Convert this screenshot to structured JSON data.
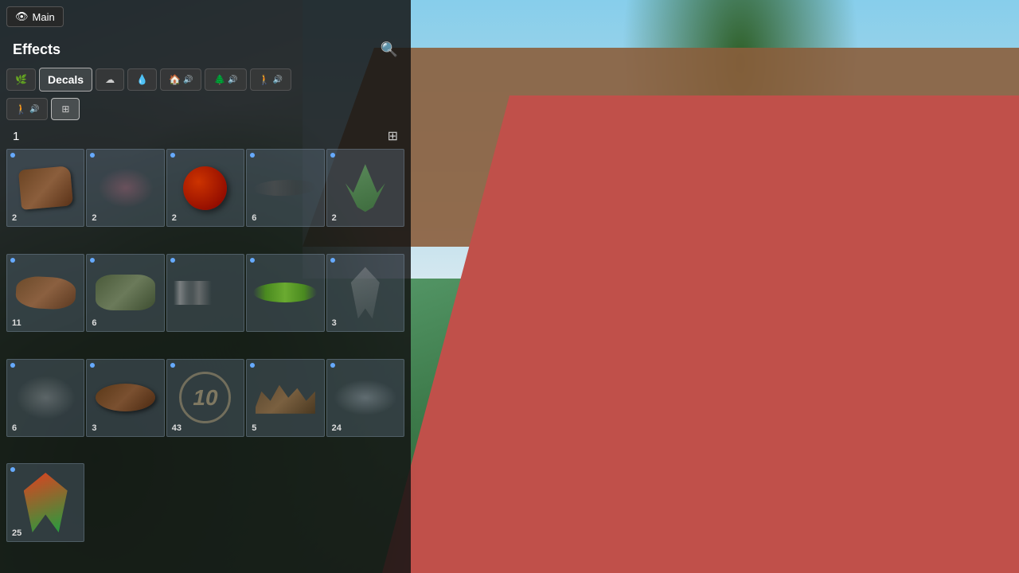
{
  "main_button": {
    "label": "Main",
    "icon": "eye"
  },
  "panel": {
    "title": "Effects",
    "search_icon": "🔍",
    "toolbar_row1": [
      {
        "id": "flower",
        "icon": "🌿",
        "label": "Flower",
        "sound": false
      },
      {
        "id": "decals",
        "icon": "",
        "label": "Decals",
        "active": true
      },
      {
        "id": "cloud",
        "icon": "☁",
        "label": "Cloud",
        "sound": false
      },
      {
        "id": "drop",
        "icon": "💧",
        "label": "Drop",
        "sound": false
      },
      {
        "id": "house",
        "icon": "🏠",
        "label": "House",
        "sound": true
      },
      {
        "id": "tree",
        "icon": "🌲",
        "label": "Tree",
        "sound": true
      },
      {
        "id": "person-sound",
        "icon": "🚶",
        "label": "Person-sound",
        "sound": true
      }
    ],
    "toolbar_row2": [
      {
        "id": "person",
        "icon": "🚶",
        "label": "Person",
        "sound": true
      },
      {
        "id": "decal-active",
        "icon": "⊞",
        "label": "Decal-active",
        "active": true
      }
    ],
    "page": "1",
    "grid_view_icon": "⊞",
    "items": [
      {
        "id": 1,
        "count": 2,
        "type": "log"
      },
      {
        "id": 2,
        "count": 2,
        "type": "smoke"
      },
      {
        "id": 3,
        "count": 2,
        "type": "ball"
      },
      {
        "id": 4,
        "count": 6,
        "type": "streak"
      },
      {
        "id": 5,
        "count": 2,
        "type": "plant"
      },
      {
        "id": 6,
        "count": 11,
        "type": "dirt"
      },
      {
        "id": 7,
        "count": 6,
        "type": "rubble"
      },
      {
        "id": 8,
        "count": 0,
        "type": "wire"
      },
      {
        "id": 9,
        "count": 0,
        "type": "grass"
      },
      {
        "id": 10,
        "count": 3,
        "type": "feather"
      },
      {
        "id": 11,
        "count": 6,
        "type": "fog"
      },
      {
        "id": 12,
        "count": 3,
        "type": "mudlog"
      },
      {
        "id": 13,
        "count": 43,
        "type": "number"
      },
      {
        "id": 14,
        "count": 5,
        "type": "ruins"
      },
      {
        "id": 15,
        "count": 24,
        "type": "mist"
      },
      {
        "id": 16,
        "count": 25,
        "type": "bird"
      }
    ]
  }
}
